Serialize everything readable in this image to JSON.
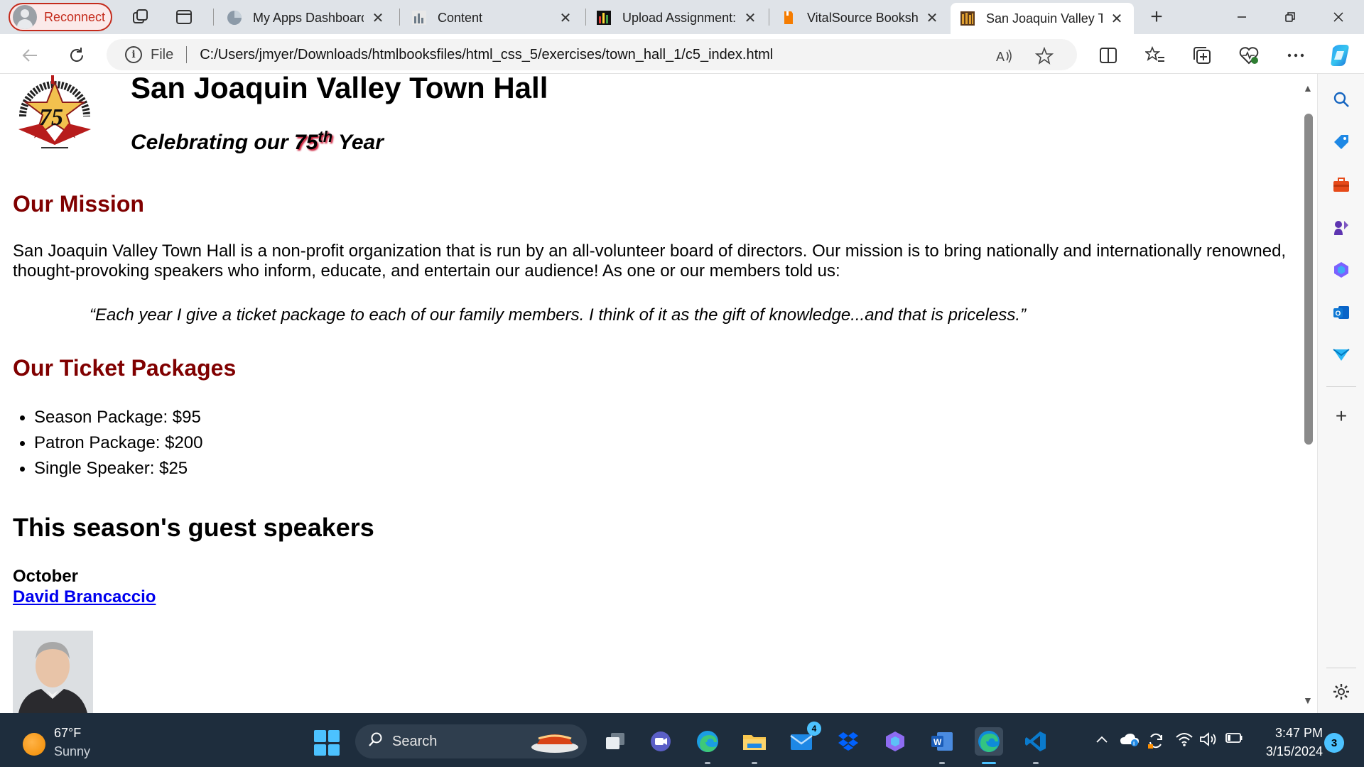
{
  "browser": {
    "reconnect_label": "Reconnect",
    "tabs": [
      {
        "title": "My Apps Dashboard",
        "favicon": "my-apps-favicon"
      },
      {
        "title": "Content",
        "favicon": "content-chart-favicon"
      },
      {
        "title": "Upload Assignment:",
        "favicon": "upload-chart-favicon"
      },
      {
        "title": "VitalSource Bookshe",
        "favicon": "vitalsource-favicon"
      },
      {
        "title": "San Joaquin Valley T",
        "favicon": "town-hall-favicon"
      }
    ],
    "address": {
      "scheme_label": "File",
      "url": "C:/Users/jmyer/Downloads/htmlbooksfiles/html_css_5/exercises/town_hall_1/c5_index.html"
    }
  },
  "page": {
    "title": "San Joaquin Valley Town Hall",
    "tagline_pre": "Celebrating our ",
    "tagline_num": "75",
    "tagline_sup": "th",
    "tagline_post": " Year",
    "mission_heading": "Our Mission",
    "mission_text": "San Joaquin Valley Town Hall is a non-profit organization that is run by an all-volunteer board of directors. Our mission is to bring nationally and internationally renowned, thought-provoking speakers who inform, educate, and entertain our audience! As one or our members told us:",
    "quote": "“Each year I give a ticket package to each of our family members. I think of it as the gift of knowledge...and that is priceless.”",
    "tickets_heading": "Our Ticket Packages",
    "packages": [
      "Season Package: $95",
      "Patron Package: $200",
      "Single Speaker: $25"
    ],
    "speakers_heading": "This season's guest speakers",
    "month": "October",
    "speaker_name": "David Brancaccio",
    "logo_text_top": "SAN JOAQUIN VALLEY TOWN HALL",
    "logo_number": "75"
  },
  "taskbar": {
    "temperature": "67°F",
    "condition": "Sunny",
    "search_label": "Search",
    "mail_badge": "4",
    "time": "3:47 PM",
    "date": "3/15/2024",
    "notifications": "3"
  },
  "colors": {
    "heading_maroon": "#800000",
    "link_blue": "#0000ee",
    "reconnect_red": "#c42b1c",
    "taskbar_bg": "#1e2d3d",
    "accent": "#4cc2ff"
  }
}
